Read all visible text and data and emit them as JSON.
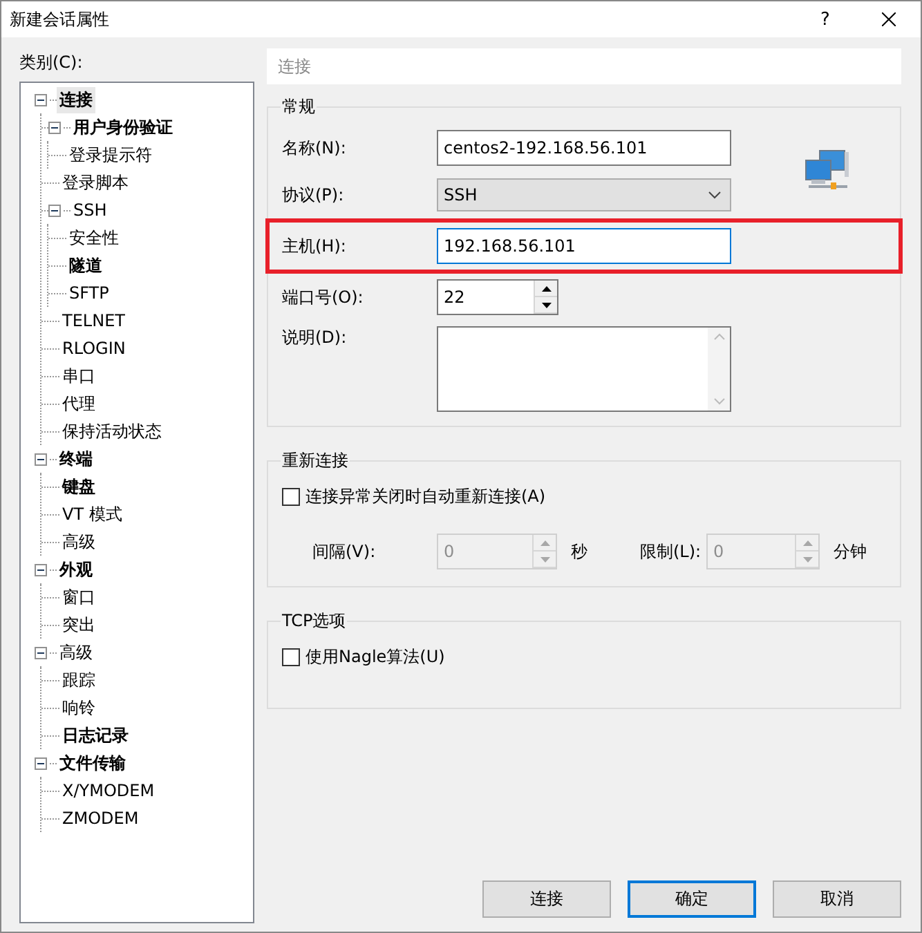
{
  "window": {
    "title": "新建会话属性",
    "help_button": "?"
  },
  "category_label": "类别(C):",
  "tree": [
    {
      "label": "连接",
      "bold": true,
      "selected": true,
      "expanded": true,
      "children": [
        {
          "label": "用户身份验证",
          "bold": true,
          "selected": false,
          "expanded": true,
          "children": [
            {
              "label": "登录提示符",
              "bold": false,
              "selected": false
            }
          ]
        },
        {
          "label": "登录脚本",
          "bold": false,
          "selected": false
        },
        {
          "label": "SSH",
          "bold": false,
          "selected": false,
          "expanded": true,
          "children": [
            {
              "label": "安全性",
              "bold": false,
              "selected": false
            },
            {
              "label": "隧道",
              "bold": true,
              "selected": false
            },
            {
              "label": "SFTP",
              "bold": false,
              "selected": false
            }
          ]
        },
        {
          "label": "TELNET",
          "bold": false,
          "selected": false
        },
        {
          "label": "RLOGIN",
          "bold": false,
          "selected": false
        },
        {
          "label": "串口",
          "bold": false,
          "selected": false
        },
        {
          "label": "代理",
          "bold": false,
          "selected": false
        },
        {
          "label": "保持活动状态",
          "bold": false,
          "selected": false
        }
      ]
    },
    {
      "label": "终端",
      "bold": true,
      "selected": false,
      "expanded": true,
      "children": [
        {
          "label": "键盘",
          "bold": true,
          "selected": false
        },
        {
          "label": "VT 模式",
          "bold": false,
          "selected": false
        },
        {
          "label": "高级",
          "bold": false,
          "selected": false
        }
      ]
    },
    {
      "label": "外观",
      "bold": true,
      "selected": false,
      "expanded": true,
      "children": [
        {
          "label": "窗口",
          "bold": false,
          "selected": false
        },
        {
          "label": "突出",
          "bold": false,
          "selected": false
        }
      ]
    },
    {
      "label": "高级",
      "bold": false,
      "selected": false,
      "expanded": true,
      "children": [
        {
          "label": "跟踪",
          "bold": false,
          "selected": false
        },
        {
          "label": "响铃",
          "bold": false,
          "selected": false
        },
        {
          "label": "日志记录",
          "bold": true,
          "selected": false
        }
      ]
    },
    {
      "label": "文件传输",
      "bold": true,
      "selected": false,
      "expanded": true,
      "children": [
        {
          "label": "X/YMODEM",
          "bold": false,
          "selected": false
        },
        {
          "label": "ZMODEM",
          "bold": false,
          "selected": false
        }
      ]
    }
  ],
  "panel_header": "连接",
  "general": {
    "title": "常规",
    "name_label": "名称(N):",
    "name_value": "centos2-192.168.56.101",
    "protocol_label": "协议(P):",
    "protocol_value": "SSH",
    "host_label": "主机(H):",
    "host_value": "192.168.56.101",
    "port_label": "端口号(O):",
    "port_value": "22",
    "description_label": "说明(D):"
  },
  "reconnect": {
    "title": "重新连接",
    "checkbox": {
      "label": "连接异常关闭时自动重新连接(A)",
      "checked": false
    },
    "disabled": true,
    "interval_label": "间隔(V):",
    "interval_value": "0",
    "interval_unit": "秒",
    "limit_label": "限制(L):",
    "limit_value": "0",
    "limit_unit": "分钟"
  },
  "tcp": {
    "title": "TCP选项",
    "checkbox": {
      "label": "使用Nagle算法(U)",
      "checked": false
    }
  },
  "buttons": [
    {
      "label": "连接",
      "default": false
    },
    {
      "label": "确定",
      "default": true
    },
    {
      "label": "取消",
      "default": false
    }
  ]
}
